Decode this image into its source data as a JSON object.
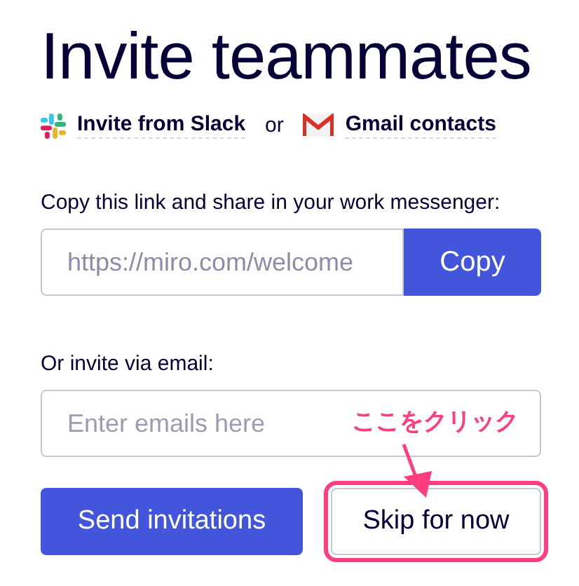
{
  "title": "Invite teammates",
  "import_links": [
    {
      "kind": "slack",
      "label": "Invite from Slack"
    },
    {
      "kind": "gmail",
      "label": "Gmail contacts"
    }
  ],
  "import_separator": "or",
  "link_section": {
    "label": "Copy this link and share in your work messenger:",
    "value": "https://miro.com/welcome",
    "button": "Copy"
  },
  "email_section": {
    "label": "Or invite via email:",
    "placeholder": "Enter emails here"
  },
  "buttons": [
    {
      "kind": "primary",
      "label": "Send invitations",
      "highlighted": false
    },
    {
      "kind": "secondary",
      "label": "Skip for now",
      "highlighted": true
    }
  ],
  "annotation": {
    "text": "ここをクリック"
  }
}
